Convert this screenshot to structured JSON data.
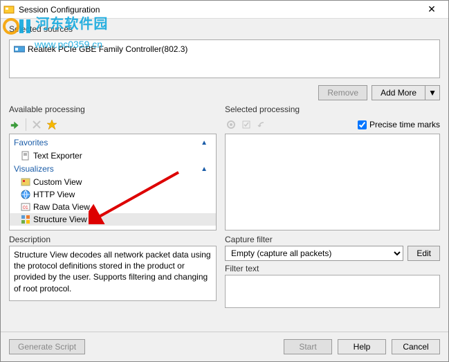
{
  "window": {
    "title": "Session Configuration",
    "close_glyph": "✕"
  },
  "sources": {
    "label": "Selected sources",
    "items": [
      {
        "name": "Realtek PCIe GBE Family Controller(802.3)"
      }
    ],
    "remove_label": "Remove",
    "add_more_label": "Add More"
  },
  "available": {
    "label": "Available processing",
    "groups": [
      {
        "name": "Favorites",
        "items": [
          {
            "label": "Text Exporter",
            "icon": "doc"
          }
        ]
      },
      {
        "name": "Visualizers",
        "items": [
          {
            "label": "Custom View",
            "icon": "custom"
          },
          {
            "label": "HTTP View",
            "icon": "http"
          },
          {
            "label": "Raw Data View",
            "icon": "raw"
          },
          {
            "label": "Structure View",
            "icon": "struct",
            "selected": true
          }
        ]
      }
    ]
  },
  "selected": {
    "label": "Selected processing",
    "precise_label": "Precise time marks",
    "precise_checked": true
  },
  "description": {
    "label": "Description",
    "text": "Structure View decodes all network packet data using the protocol definitions stored in the product or provided by the user. Supports filtering and changing of root protocol."
  },
  "capture_filter": {
    "label": "Capture filter",
    "selected": "Empty (capture all packets)",
    "edit_label": "Edit",
    "filter_text_label": "Filter text"
  },
  "footer": {
    "generate_script": "Generate Script",
    "start": "Start",
    "help": "Help",
    "cancel": "Cancel"
  },
  "watermark": {
    "text": "河东软件园",
    "url": "www.pc0359.cn"
  }
}
